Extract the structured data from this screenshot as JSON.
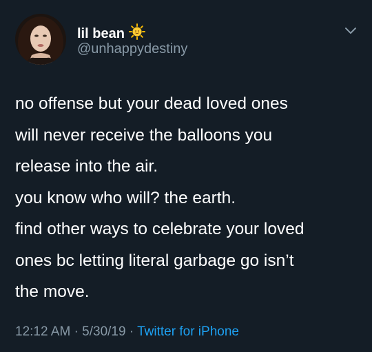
{
  "tweet": {
    "display_name": "lil bean",
    "handle": "@unhappydestiny",
    "text": "no offense but your dead loved ones\nwill never receive the balloons you\nrelease into the air.\nyou know who will? the earth.\nfind other ways to celebrate your loved\nones bc letting literal garbage go isn’t\nthe move.",
    "time": "12:12 AM",
    "date": "5/30/19",
    "separator": "·",
    "source": "Twitter for iPhone"
  },
  "icons": {
    "name_emoji": "sun-with-face-icon",
    "menu": "chevron-down-icon"
  },
  "colors": {
    "background": "#141d26",
    "secondary_text": "#8899a6",
    "link": "#1da1f2"
  }
}
